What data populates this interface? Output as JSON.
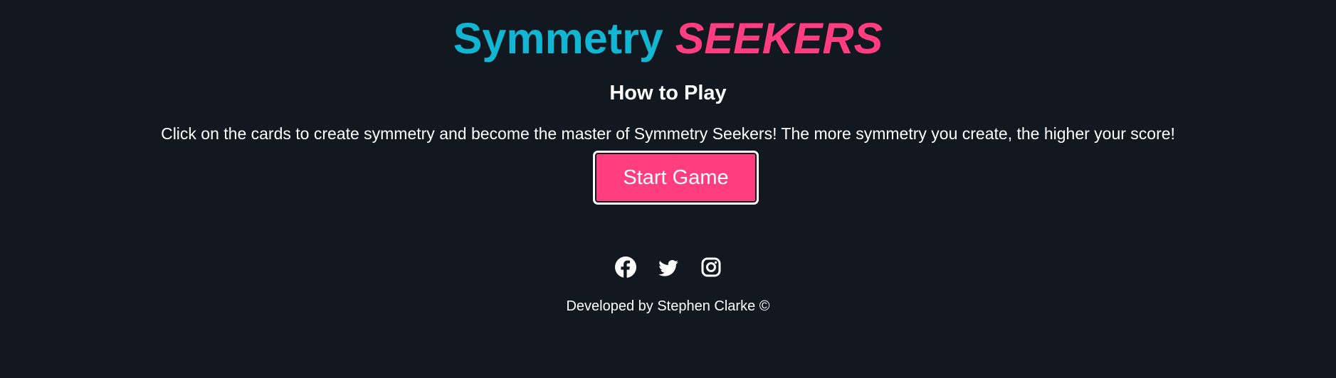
{
  "header": {
    "title_part1": "Symmetry",
    "title_part2": "SEEKERS"
  },
  "instructions": {
    "heading": "How to Play",
    "text": "Click on the cards to create symmetry and become the master of Symmetry Seekers! The more symmetry you create, the higher your score!"
  },
  "actions": {
    "start_label": "Start Game"
  },
  "social": {
    "icons": [
      "facebook-icon",
      "twitter-icon",
      "instagram-icon"
    ]
  },
  "footer": {
    "credit": "Developed by Stephen Clarke ©"
  },
  "colors": {
    "background": "#111820",
    "title_primary": "#13b6d2",
    "title_accent": "#ff3d7f",
    "button": "#ff3d7f",
    "text": "#ffffff"
  }
}
